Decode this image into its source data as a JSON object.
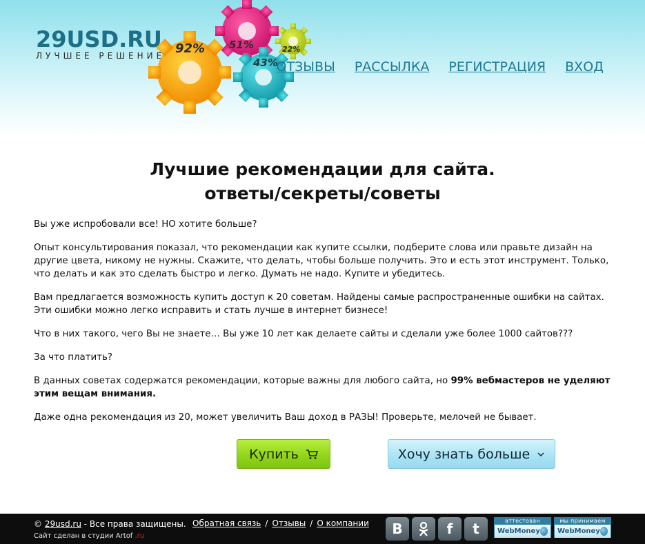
{
  "logo": {
    "text": "29USD.RU",
    "subtitle": "ЛУЧШЕЕ РЕШЕНИЕ"
  },
  "gears": {
    "pct1": "92%",
    "pct2": "51%",
    "pct3": "43%",
    "pct4": "22%"
  },
  "nav": {
    "items": [
      {
        "label": "ОТЗЫВЫ"
      },
      {
        "label": "РАССЫЛКА"
      },
      {
        "label": "РЕГИСТРАЦИЯ"
      },
      {
        "label": "ВХОД"
      }
    ]
  },
  "main": {
    "title_line1": "Лучшие рекомендации для сайта.",
    "title_line2": "ответы/секреты/советы",
    "p1": "Вы уже испробовали все! НО хотите больше?",
    "p2": "Опыт консультирования показал, что рекомендации как купите ссылки, подберите слова или правьте дизайн на другие цвета, никому не нужны. Скажите, что делать, чтобы больше получить. Это и есть этот инструмент. Только, что делать и как это сделать быстро и легко. Думать не надо. Купите и убедитесь.",
    "p3": "Вам предлагается возможность купить доступ  к 20 советам. Найдены самые распространенные ошибки на сайтах. Эти ошибки можно легко исправить и стать лучше в интернет бизнесе!",
    "p4": "Что в них такого, чего Вы не знаете… Вы уже 10 лет как делаете сайты и сделали уже более 1000 сайтов???",
    "p5": "За что платить?",
    "p6_start": "В данных советах содержатся рекомендации, которые важны для любого сайта, но ",
    "p6_bold": "99% вебмастеров не уделяют этим вещам внимания.",
    "p7": "Даже одна рекомендация из 20, может увеличить Ваш доход в РАЗЫ! Проверьте, мелочей не бывает."
  },
  "buttons": {
    "buy": "Купить",
    "more": "Хочу знать больше"
  },
  "footer": {
    "copyright_prefix": "© ",
    "site_link": "29usd.ru",
    "copyright_suffix": " - Все права защищены.",
    "made_prefix": "Сайт сделан в студии Artof",
    "made_suffix": ".ru",
    "links": [
      {
        "label": "Обратная связь"
      },
      {
        "label": "Отзывы"
      },
      {
        "label": "О компании"
      }
    ],
    "separator": "/",
    "social": {
      "vk": "B",
      "fb": "f",
      "tw": "t"
    },
    "wm1": {
      "top": "аттестован",
      "bottom": "WebMoney"
    },
    "wm2": {
      "top": "мы принимаем",
      "bottom": "WebMoney"
    }
  },
  "colors": {
    "accent": "#1d7a97",
    "buy_green": "#8fd31a",
    "more_blue": "#a9e3f4",
    "footer_bg": "#0d0d0d"
  }
}
